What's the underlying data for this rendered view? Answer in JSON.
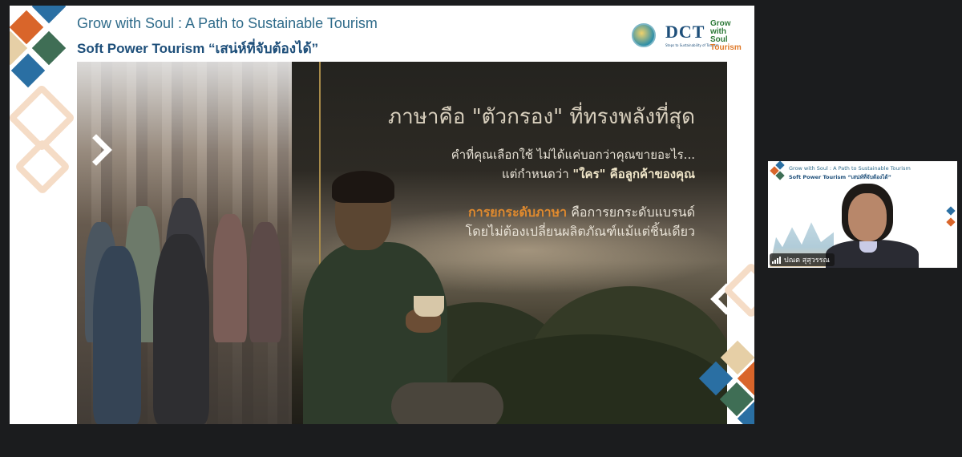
{
  "slide": {
    "title": "Grow with Soul : A Path to Sustainable Tourism",
    "subtitle": "Soft Power Tourism “เสน่ห์ที่จับต้องได้”",
    "logos": {
      "dct": "DCT",
      "dct_sub": "Steps to Sustainability of Tourism",
      "gws_line1": "Grow",
      "gws_line2": "with Soul",
      "gws_line3": "Tourism"
    },
    "heading_prefix": "ภาษาคือ ",
    "heading_quote": "\"ตัวกรอง\"",
    "heading_suffix": " ที่ทรงพลังที่สุด",
    "line1": "คำที่คุณเลือกใช้ ไม่ได้แค่บอกว่าคุณขายอะไร...",
    "line2_prefix": "แต่กำหนดว่า ",
    "line2_quote": "\"ใคร\"",
    "line2_bold": " คือลูกค้าของคุณ",
    "line3_bold": "การยกระดับภาษา",
    "line3_rest": " คือการยกระดับแบรนด์",
    "line4": "โดยไม่ต้องเปลี่ยนผลิตภัณฑ์แม้แต่ชิ้นเดียว"
  },
  "video_tile": {
    "title": "Grow with Soul : A Path to Sustainable Tourism",
    "subtitle": "Soft Power Tourism “เสน่ห์ที่จับต้องได้”",
    "participant_name": "ปณต สุสุวรรณ",
    "signal_icon": "signal-bars-icon"
  },
  "colors": {
    "brand_blue": "#1e4f7a",
    "accent_orange": "#e08a2e",
    "diamond_orange": "#d9652a",
    "diamond_green": "#3f6e55",
    "diamond_blue": "#2a6fa3",
    "diamond_tan": "#e6cfa6"
  }
}
